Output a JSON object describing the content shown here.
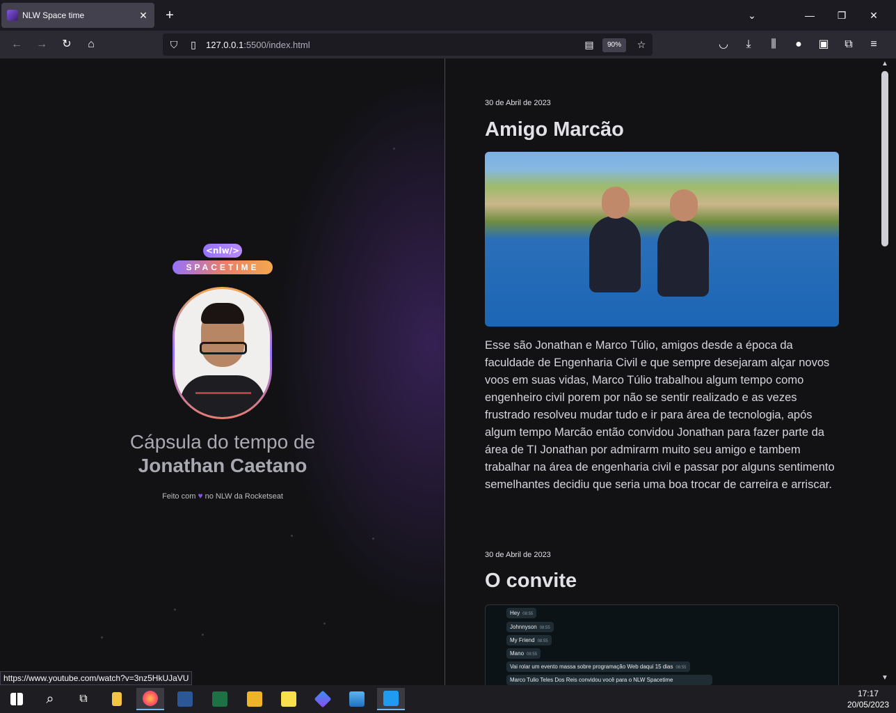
{
  "browser": {
    "tab_title": "NLW Space time",
    "tab_close": "✕",
    "new_tab": "+",
    "url_host": "127.0.0.1",
    "url_path": ":5500/index.html",
    "zoom": "90%",
    "status_url": "https://www.youtube.com/watch?v=3nz5HkUJaVU"
  },
  "sidebar": {
    "logo_top": "<nlw/>",
    "logo_bottom": "SPACETIME",
    "title_line1": "Cápsula do tempo de",
    "title_line2": "Jonathan Caetano",
    "made_with_prefix": "Feito com",
    "made_with_suffix": "no NLW da Rocketseat"
  },
  "memories": [
    {
      "date": "30 de Abril de 2023",
      "title": "Amigo Marcão",
      "text": "Esse são Jonathan e Marco Túlio, amigos desde a época da faculdade de Engenharia Civil e que sempre desejaram alçar novos voos em suas vidas, Marco Túlio trabalhou algum tempo como engenheiro civil porem por não se sentir realizado e as vezes frustrado resolveu mudar tudo e ir para área de tecnologia, após algum tempo Marcão então convidou Jonathan para fazer parte da área de TI Jonathan por admirarm muito seu amigo e tambem trabalhar na área de engenharia civil e passar por alguns sentimento semelhantes decidiu que seria uma boa trocar de carreira e arriscar."
    },
    {
      "date": "30 de Abril de 2023",
      "title": "O convite",
      "chat": [
        {
          "text": "Hey",
          "time": "08:55"
        },
        {
          "text": "Johnnyson",
          "time": "08:55"
        },
        {
          "text": "My Friend",
          "time": "08:55"
        },
        {
          "text": "Mano",
          "time": "08:55"
        },
        {
          "text": "Vai rolar um evento massa sobre programação Web daqui 15 dias",
          "time": "08:55"
        },
        {
          "text": "Marco Tulio Teles Dos Reis convidou você para o NLW Spacetime",
          "time": ""
        }
      ]
    }
  ],
  "taskbar": {
    "time": "17:17",
    "date": "20/05/2023"
  }
}
